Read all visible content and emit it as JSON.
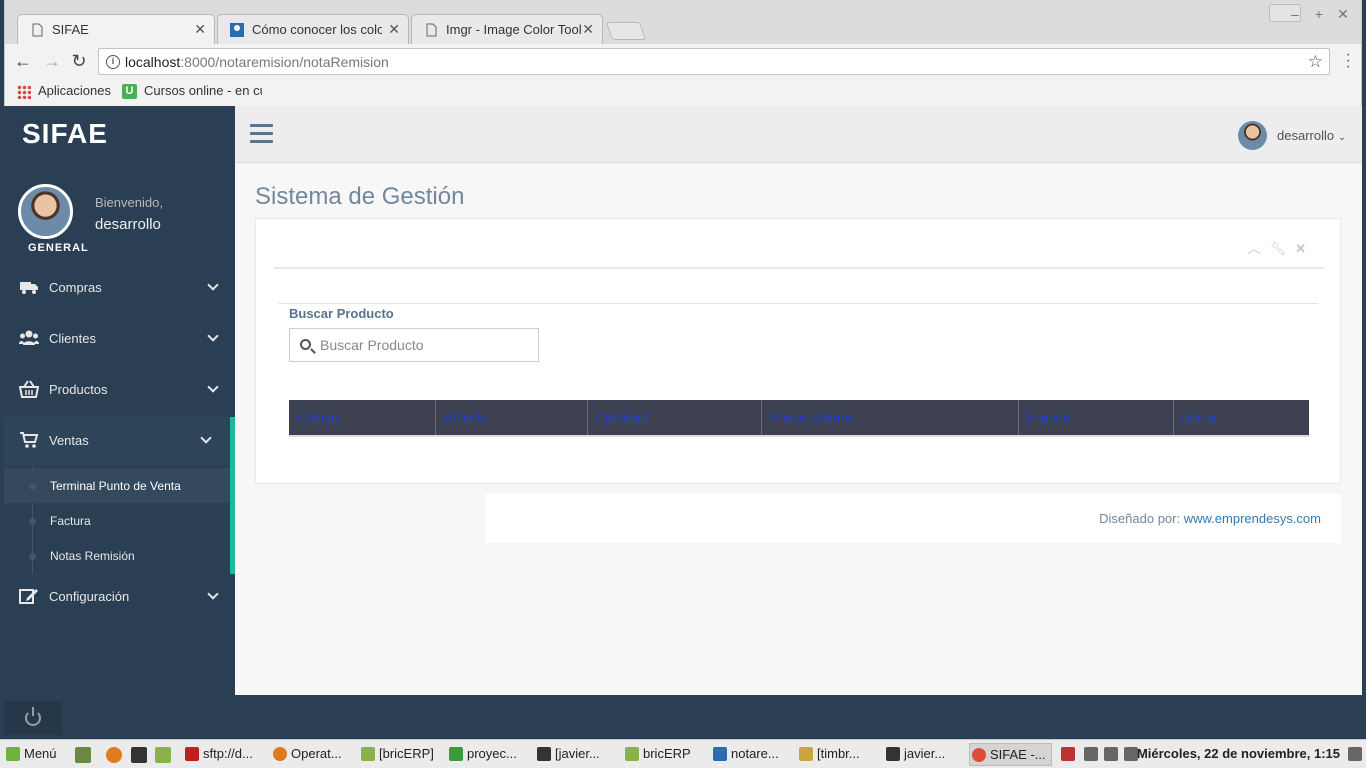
{
  "browser": {
    "tabs": [
      {
        "title": "SIFAE",
        "active": true
      },
      {
        "title": "Cómo conocer los color",
        "active": false
      },
      {
        "title": "Imgr - Image Color Tool",
        "active": false
      }
    ],
    "url_host": "localhost",
    "url_path": ":8000/notaremision/notaRemision",
    "bookmarks": [
      "Aplicaciones",
      "Cursos online - en cu"
    ]
  },
  "sidebar": {
    "brand": "SIFAE",
    "welcome": "Bienvenido,",
    "username": "desarrollo",
    "role": "GENERAL",
    "items": [
      {
        "label": "Compras",
        "icon": "truck-icon"
      },
      {
        "label": "Clientes",
        "icon": "users-icon"
      },
      {
        "label": "Productos",
        "icon": "basket-icon"
      },
      {
        "label": "Ventas",
        "icon": "cart-icon"
      },
      {
        "label": "Configuración",
        "icon": "edit-icon"
      }
    ],
    "ventas_sub": [
      "Terminal Punto de Venta",
      "Factura",
      "Notas Remisión"
    ]
  },
  "topnav": {
    "username": "desarrollo"
  },
  "main": {
    "title": "Sistema de Gestión",
    "search_label": "Buscar Producto",
    "search_placeholder": "Buscar Producto",
    "table_headers": [
      "Código",
      "Articulo",
      "Cantidad",
      "Precio Unitario",
      "Importe",
      "Borrar"
    ]
  },
  "footer": {
    "text": "Diseñado por: ",
    "link": "www.emprendesys.com"
  },
  "taskbar": {
    "menu": "Menú",
    "items": [
      "sftp://d...",
      "Operat...",
      "[bricERP]",
      "proyec...",
      "[javier...",
      "bricERP",
      "notare...",
      "[timbr...",
      "javier...",
      "SIFAE -..."
    ],
    "clock": "Miércoles, 22 de noviembre,  1:15"
  },
  "colors": {
    "sidebar_bg": "#2a3f54",
    "accent": "#1abb9c",
    "table_header_bg": "#3e4152"
  }
}
